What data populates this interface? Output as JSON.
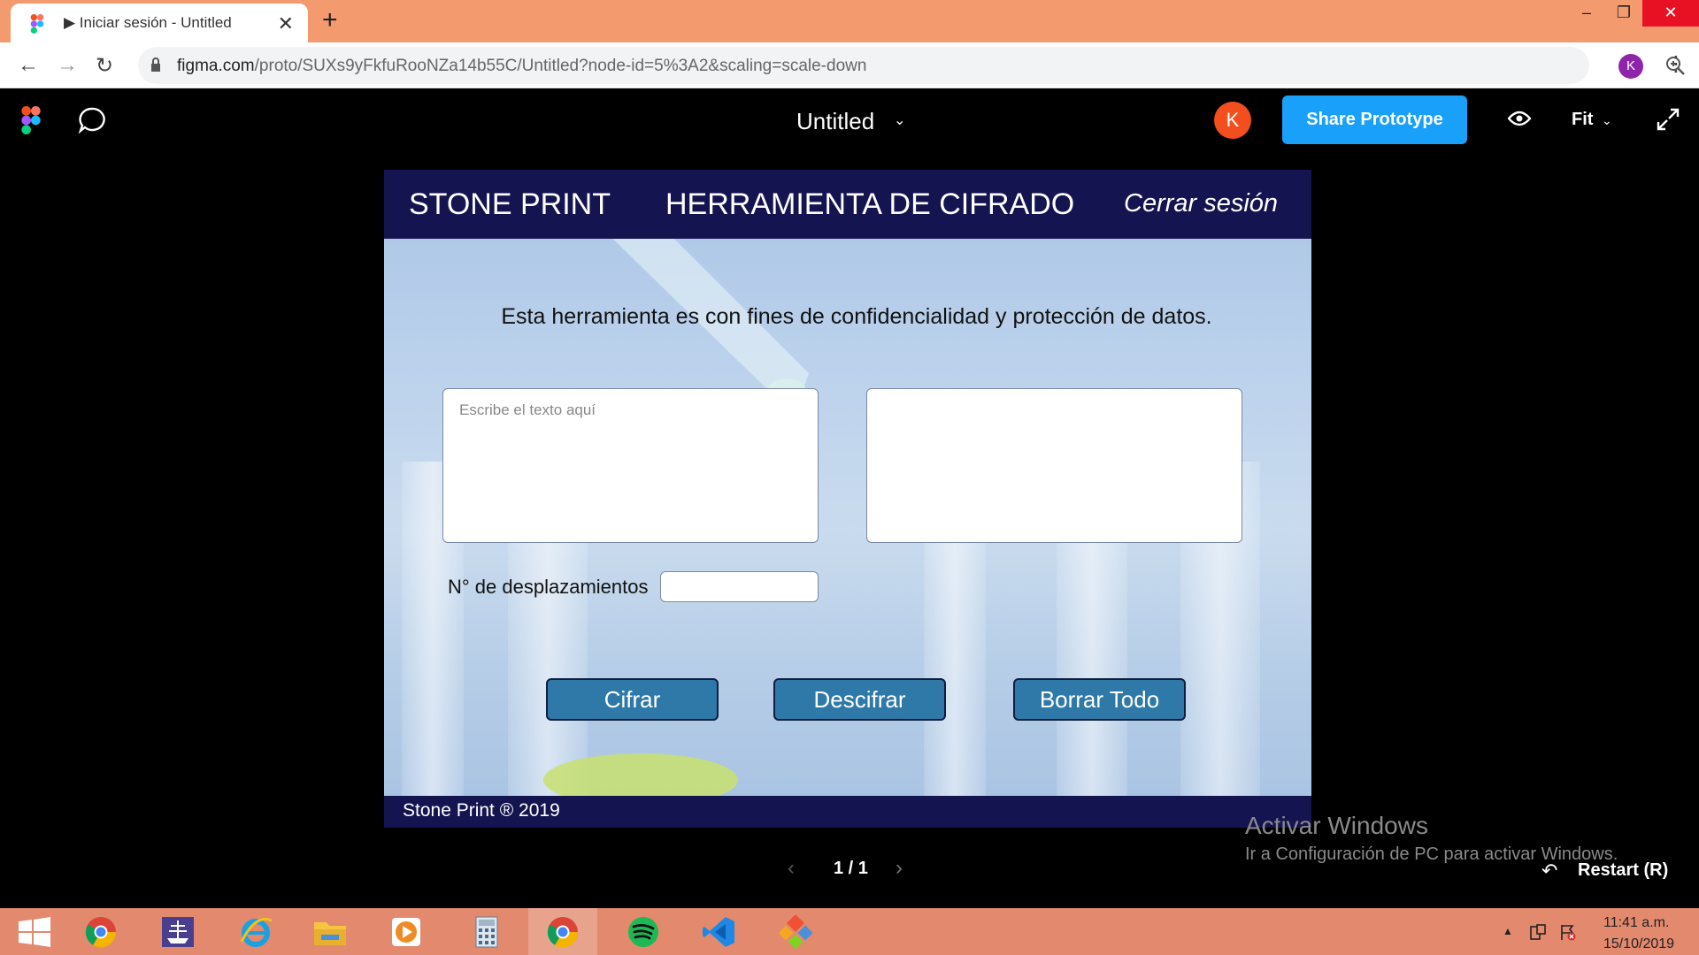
{
  "browser": {
    "tab_title": "▶ Iniciar sesión - Untitled",
    "tab_close": "✕",
    "new_tab": "+",
    "url_host": "figma.com",
    "url_path": "/proto/SUXs9yFkfuRooNZa14b55C/Untitled?node-id=5%3A2&scaling=scale-down",
    "profile_initial": "K",
    "window_min": "–",
    "window_max": "❐",
    "window_close": "✕"
  },
  "figma": {
    "file_title": "Untitled",
    "user_initial": "K",
    "share_label": "Share Prototype",
    "fit_label": "Fit",
    "page_counter": "1 / 1",
    "restart_label": "Restart (R)"
  },
  "prototype": {
    "brand": "STONE PRINT",
    "tool_title": "HERRAMIENTA DE CIFRADO",
    "logout_label": "Cerrar sesión",
    "description": "Esta herramienta es con fines de confidencialidad y protección de datos.",
    "input_placeholder": "Escribe el texto aquí",
    "input_value": "",
    "output_value": "",
    "shift_label": "N° de desplazamientos",
    "shift_value": "",
    "buttons": {
      "encrypt": "Cifrar",
      "decrypt": "Descifrar",
      "clear": "Borrar Todo"
    },
    "footer": "Stone Print ®  2019"
  },
  "watermark": {
    "title": "Activar Windows",
    "subtitle": "Ir a Configuración de PC para activar Windows."
  },
  "taskbar": {
    "time": "11:41 a.m.",
    "date": "15/10/2019",
    "items": [
      "windows-start",
      "chrome",
      "ship-app",
      "internet-explorer",
      "file-explorer",
      "media-player",
      "calculator",
      "chrome-active",
      "spotify",
      "vscode",
      "git-app"
    ]
  },
  "colors": {
    "accent": "#18a0fb",
    "header_navy": "#141450",
    "button_blue": "#2e79a7",
    "avatar_orange": "#f24e1e",
    "tabbar": "#f39a6f",
    "taskbar": "#e2896e"
  }
}
